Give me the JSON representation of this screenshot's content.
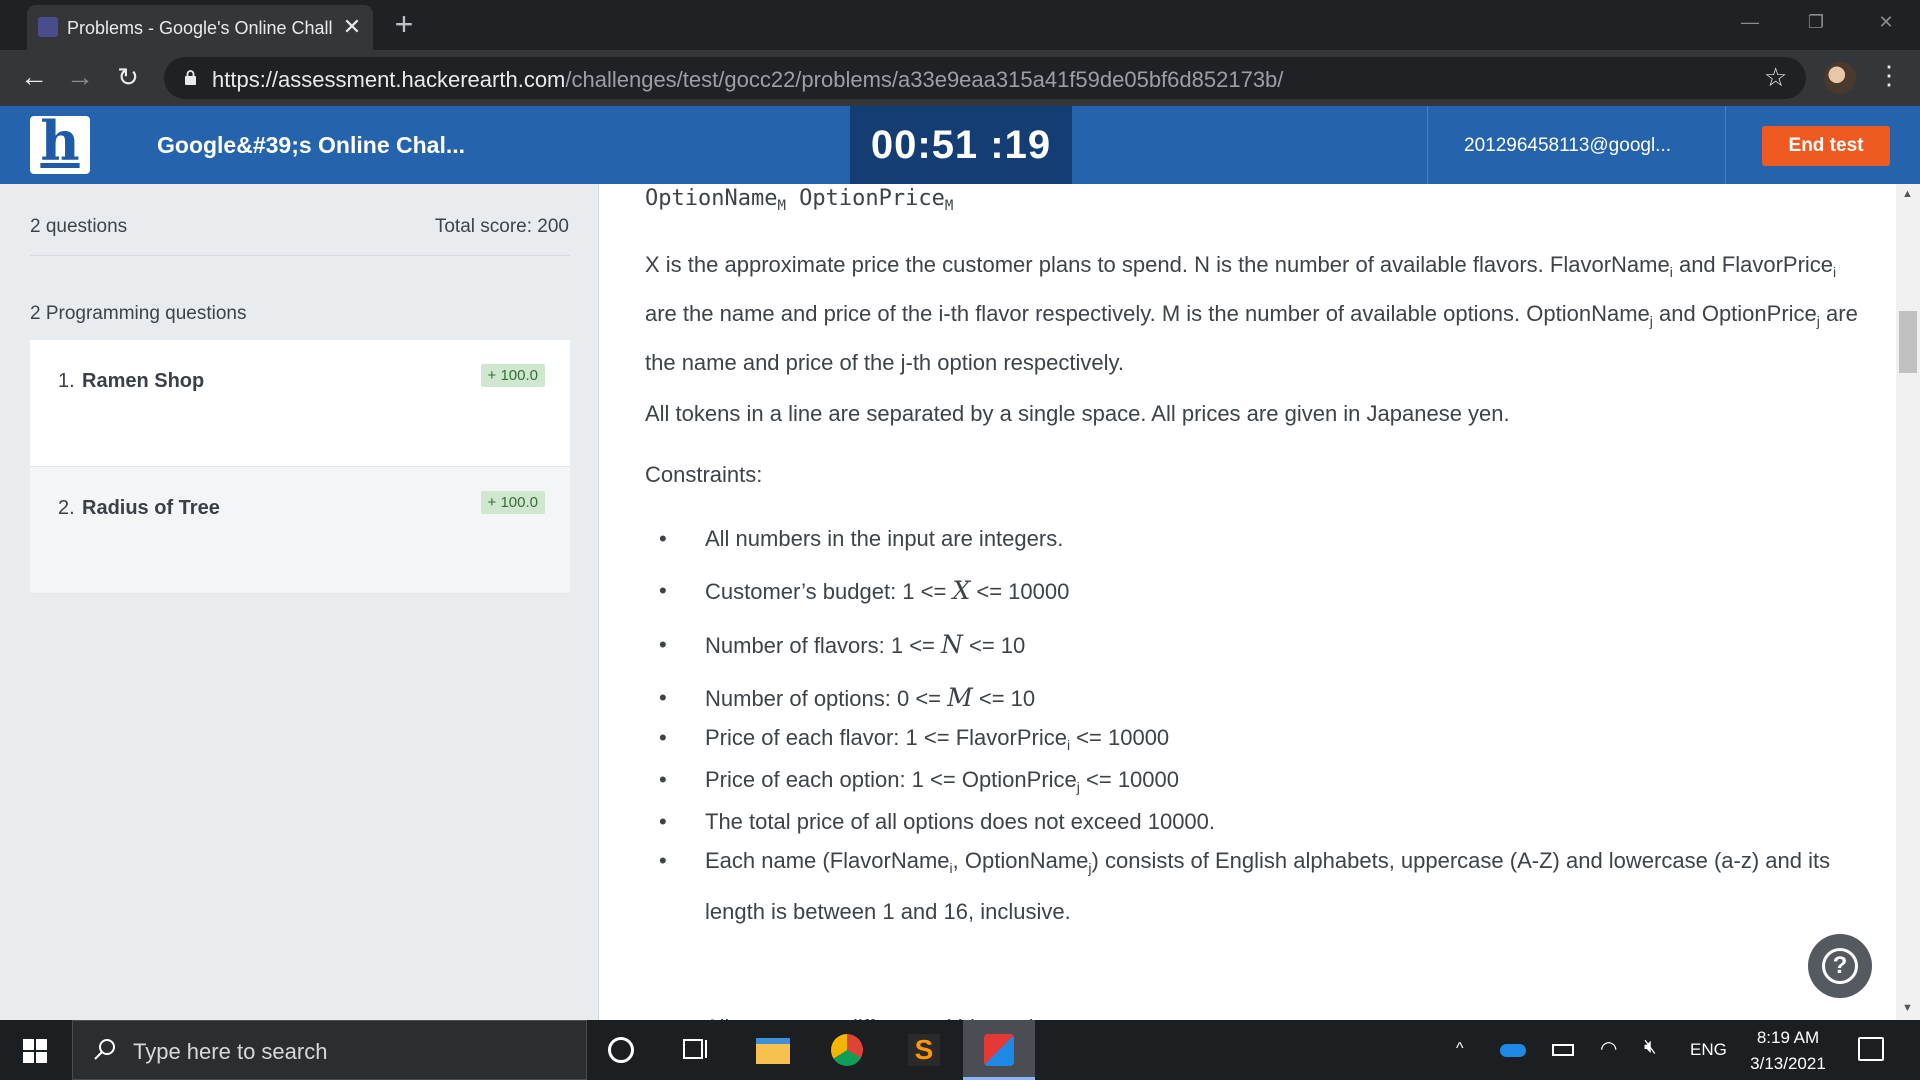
{
  "browser": {
    "tab_title": "Problems - Google's Online Chall",
    "tab_close": "✕",
    "new_tab": "+",
    "url_host": "https://assessment.hackerearth.com",
    "url_path": "/challenges/test/gocc22/problems/a33e9eaa315a41f59de05bf6d852173b/"
  },
  "header": {
    "logo_letter": "h",
    "challenge_title": "Google&#39;s Online Chal...",
    "timer": "00:51 :19",
    "user_email": "201296458113@googl...",
    "end_test_label": "End test"
  },
  "sidebar": {
    "question_count": "2 questions",
    "total_score": "Total score: 200",
    "programming_heading": "2 Programming questions",
    "questions": [
      {
        "number": "1.",
        "name": "Ramen Shop",
        "score": "+ 100.0"
      },
      {
        "number": "2.",
        "name": "Radius of Tree",
        "score": "+ 100.0"
      }
    ]
  },
  "problem": {
    "var_option_name": "OptionName",
    "var_option_price": "OptionPrice",
    "var_subscript": "M",
    "para1_parts": [
      "X is the approximate price the customer plans to spend. N is the number of available flavors. FlavorName",
      "i",
      " and FlavorPrice",
      "i",
      " are the name and price of the i-th flavor respectively. M is the number of available options. OptionName",
      "j",
      " and OptionPrice",
      "j",
      " are the name and price of the j-th option respectively."
    ],
    "para2": "All tokens in a line are separated by a single space. All prices are given in Japanese yen.",
    "constraints_label": "Constraints:",
    "bullets": {
      "b1": "All numbers in the input are integers.",
      "b2_pre": "Customer’s budget: 1 <= ",
      "b2_var": "X",
      "b2_post": " <= 10000",
      "b3_pre": "Number of flavors: 1 <= ",
      "b3_var": "N",
      "b3_post": " <= 10",
      "b4_pre": "Number of options: 0 <= ",
      "b4_var": "M",
      "b4_post": " <= 10",
      "b5_pre": "Price of each flavor: 1 <= FlavorPrice",
      "b5_sub": "i",
      "b5_post": " <= 10000",
      "b6_pre": "Price of each option: 1 <= OptionPrice",
      "b6_sub": "j",
      "b6_post": " <= 10000",
      "b7": "The total price of all options does not exceed 10000.",
      "b8_a": "Each name (FlavorName",
      "b8_sub1": "i",
      "b8_b": ", OptionName",
      "b8_sub2": "j",
      "b8_c": ") consists of English alphabets, uppercase (A-Z) and lowercase (a-z) and its length is between 1 and 16, inclusive.",
      "b9": "All names are different within each test case."
    },
    "help_label": "?"
  },
  "taskbar": {
    "search_placeholder": "Type here to search",
    "language": "ENG",
    "time": "8:19 AM",
    "date": "3/13/2021"
  },
  "colors": {
    "header_blue": "#2563ad",
    "timer_bg": "#143e73",
    "end_test_orange": "#ef5a22",
    "score_badge": "#cfe6cf"
  },
  "icons": [
    "lock-icon",
    "star-icon",
    "menu-icon",
    "search-icon",
    "chrome-icon",
    "help-icon"
  ]
}
